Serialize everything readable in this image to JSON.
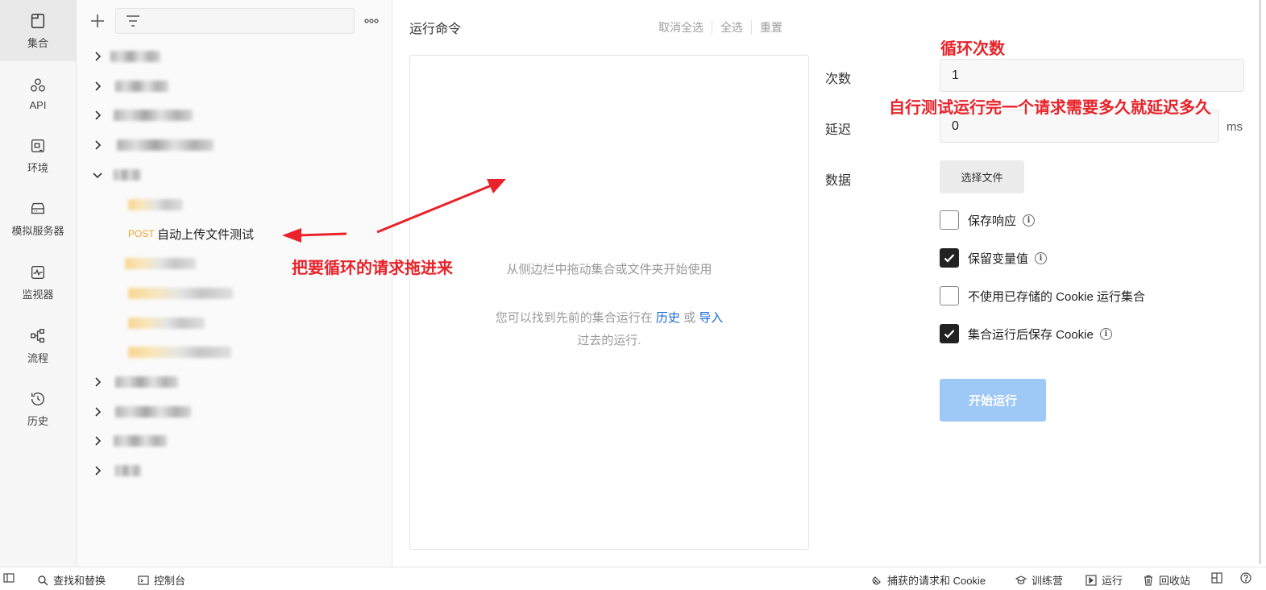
{
  "sidebar": {
    "items": [
      {
        "label": "集合",
        "icon": "collection-icon"
      },
      {
        "label": "API",
        "icon": "api-icon"
      },
      {
        "label": "环境",
        "icon": "environment-icon"
      },
      {
        "label": "模拟服务器",
        "icon": "mock-server-icon"
      },
      {
        "label": "监视器",
        "icon": "monitor-icon"
      },
      {
        "label": "流程",
        "icon": "flow-icon"
      },
      {
        "label": "历史",
        "icon": "history-icon"
      }
    ]
  },
  "collections": {
    "visible_request": {
      "method": "POST",
      "name": "自动上传文件测试"
    }
  },
  "runner": {
    "title": "运行命令",
    "deselect_all": "取消全选",
    "select_all": "全选",
    "reset": "重置",
    "empty_hint": "从侧边栏中拖动集合或文件夹开始使用",
    "history_prefix": "您可以找到先前的集合运行在",
    "history_link": "历史",
    "or": "或",
    "import_link": "导入",
    "history_suffix": "过去的运行."
  },
  "settings": {
    "iterations_label": "次数",
    "iterations_value": "1",
    "delay_label": "延迟",
    "delay_value": "0",
    "delay_unit": "ms",
    "data_label": "数据",
    "choose_file": "选择文件",
    "options": [
      {
        "label": "保存响应",
        "checked": false,
        "info": true
      },
      {
        "label": "保留变量值",
        "checked": true,
        "info": true
      },
      {
        "label": "不使用已存储的 Cookie 运行集合",
        "checked": false,
        "info": false
      },
      {
        "label": "集合运行后保存 Cookie",
        "checked": true,
        "info": true
      }
    ],
    "start_button": "开始运行"
  },
  "annotations": {
    "loop_count": "循环次数",
    "delay_note": "自行测试运行完一个请求需要多久就延迟多久",
    "drag_note": "把要循环的请求拖进来"
  },
  "statusbar": {
    "find_replace": "查找和替换",
    "console": "控制台",
    "capture": "捕获的请求和 Cookie",
    "bootcamp": "训练营",
    "runner": "运行",
    "trash": "回收站"
  },
  "colors": {
    "annotation": "#e8232a",
    "link": "#1668d6",
    "post_method": "#f0a52a",
    "run_button": "#9ec8f6"
  }
}
